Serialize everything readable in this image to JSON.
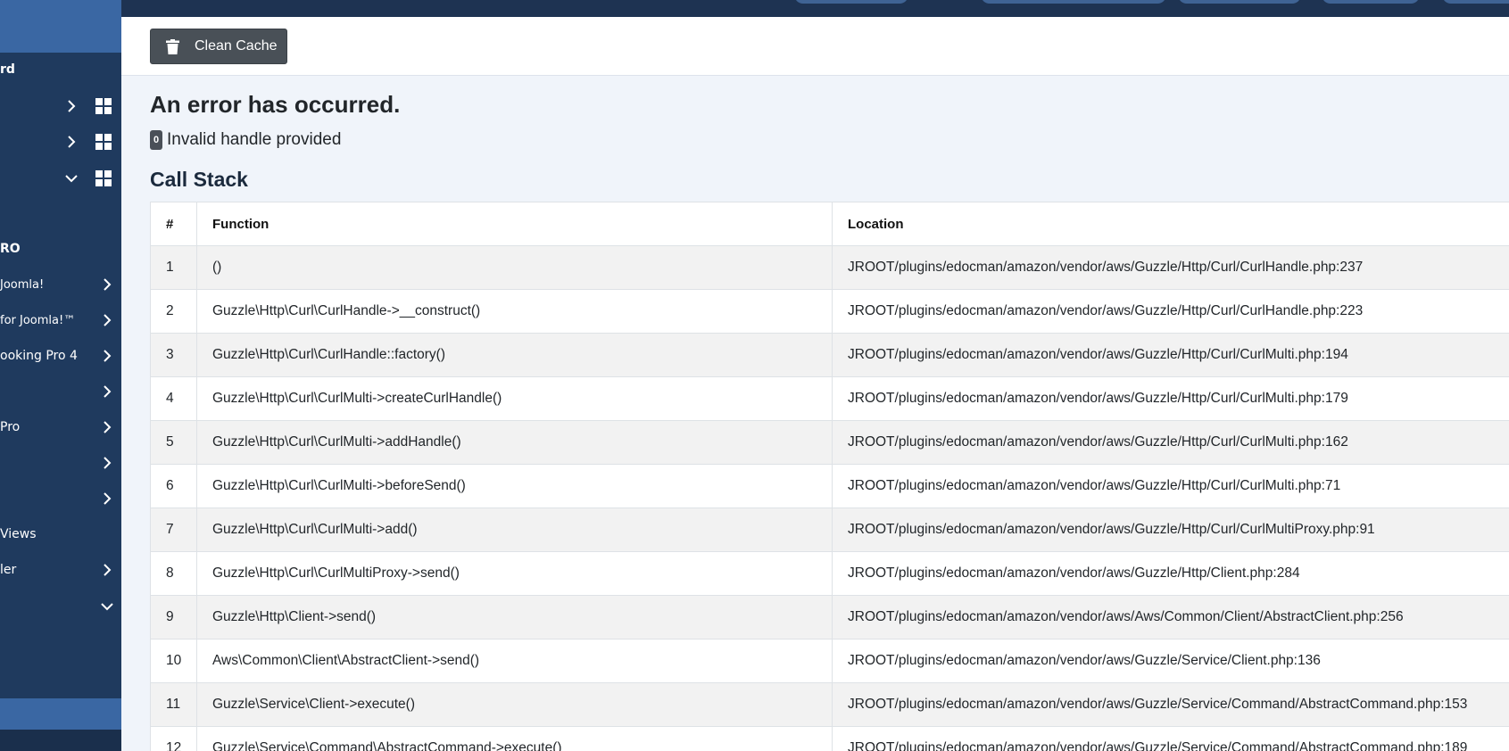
{
  "toolbar": {
    "clean_cache_label": "Clean Cache"
  },
  "error": {
    "title": "An error has occurred.",
    "code": "0",
    "message": "Invalid handle provided"
  },
  "callstack": {
    "title": "Call Stack",
    "headers": {
      "num": "#",
      "function": "Function",
      "location": "Location"
    },
    "rows": [
      {
        "num": "1",
        "function": "()",
        "location": "JROOT/plugins/edocman/amazon/vendor/aws/Guzzle/Http/Curl/CurlHandle.php:237"
      },
      {
        "num": "2",
        "function": "Guzzle\\Http\\Curl\\CurlHandle->__construct()",
        "location": "JROOT/plugins/edocman/amazon/vendor/aws/Guzzle/Http/Curl/CurlHandle.php:223"
      },
      {
        "num": "3",
        "function": "Guzzle\\Http\\Curl\\CurlHandle::factory()",
        "location": "JROOT/plugins/edocman/amazon/vendor/aws/Guzzle/Http/Curl/CurlMulti.php:194"
      },
      {
        "num": "4",
        "function": "Guzzle\\Http\\Curl\\CurlMulti->createCurlHandle()",
        "location": "JROOT/plugins/edocman/amazon/vendor/aws/Guzzle/Http/Curl/CurlMulti.php:179"
      },
      {
        "num": "5",
        "function": "Guzzle\\Http\\Curl\\CurlMulti->addHandle()",
        "location": "JROOT/plugins/edocman/amazon/vendor/aws/Guzzle/Http/Curl/CurlMulti.php:162"
      },
      {
        "num": "6",
        "function": "Guzzle\\Http\\Curl\\CurlMulti->beforeSend()",
        "location": "JROOT/plugins/edocman/amazon/vendor/aws/Guzzle/Http/Curl/CurlMulti.php:71"
      },
      {
        "num": "7",
        "function": "Guzzle\\Http\\Curl\\CurlMulti->add()",
        "location": "JROOT/plugins/edocman/amazon/vendor/aws/Guzzle/Http/Curl/CurlMultiProxy.php:91"
      },
      {
        "num": "8",
        "function": "Guzzle\\Http\\Curl\\CurlMultiProxy->send()",
        "location": "JROOT/plugins/edocman/amazon/vendor/aws/Guzzle/Http/Client.php:284"
      },
      {
        "num": "9",
        "function": "Guzzle\\Http\\Client->send()",
        "location": "JROOT/plugins/edocman/amazon/vendor/aws/Aws/Common/Client/AbstractClient.php:256"
      },
      {
        "num": "10",
        "function": "Aws\\Common\\Client\\AbstractClient->send()",
        "location": "JROOT/plugins/edocman/amazon/vendor/aws/Guzzle/Service/Client.php:136"
      },
      {
        "num": "11",
        "function": "Guzzle\\Service\\Client->execute()",
        "location": "JROOT/plugins/edocman/amazon/vendor/aws/Guzzle/Service/Command/AbstractCommand.php:153"
      },
      {
        "num": "12",
        "function": "Guzzle\\Service\\Command\\AbstractCommand->execute()",
        "location": "JROOT/plugins/edocman/amazon/vendor/aws/Guzzle/Service/Command/AbstractCommand.php:189"
      }
    ]
  },
  "sidebar": {
    "items": [
      {
        "label": "rd",
        "style": "bold"
      },
      {
        "label": "",
        "style": ""
      },
      {
        "label": "",
        "style": ""
      },
      {
        "label": "",
        "style": ""
      },
      {
        "label": "RO",
        "style": "bold"
      },
      {
        "label": "Joomla!",
        "style": "small"
      },
      {
        "label": "for Joomla!™",
        "style": "small"
      },
      {
        "label": "ooking Pro 4",
        "style": ""
      },
      {
        "label": "",
        "style": ""
      },
      {
        "label": "Pro",
        "style": ""
      },
      {
        "label": "",
        "style": ""
      },
      {
        "label": "",
        "style": ""
      },
      {
        "label": "Views",
        "style": ""
      },
      {
        "label": "ler",
        "style": ""
      },
      {
        "label": "",
        "style": ""
      }
    ]
  },
  "colors": {
    "sidebar_bg": "#1f3a5e",
    "sidebar_highlight": "#3a67a3",
    "topbar_bg": "#1e3352",
    "button_bg": "#495057",
    "content_bg": "#f0f4fa"
  }
}
